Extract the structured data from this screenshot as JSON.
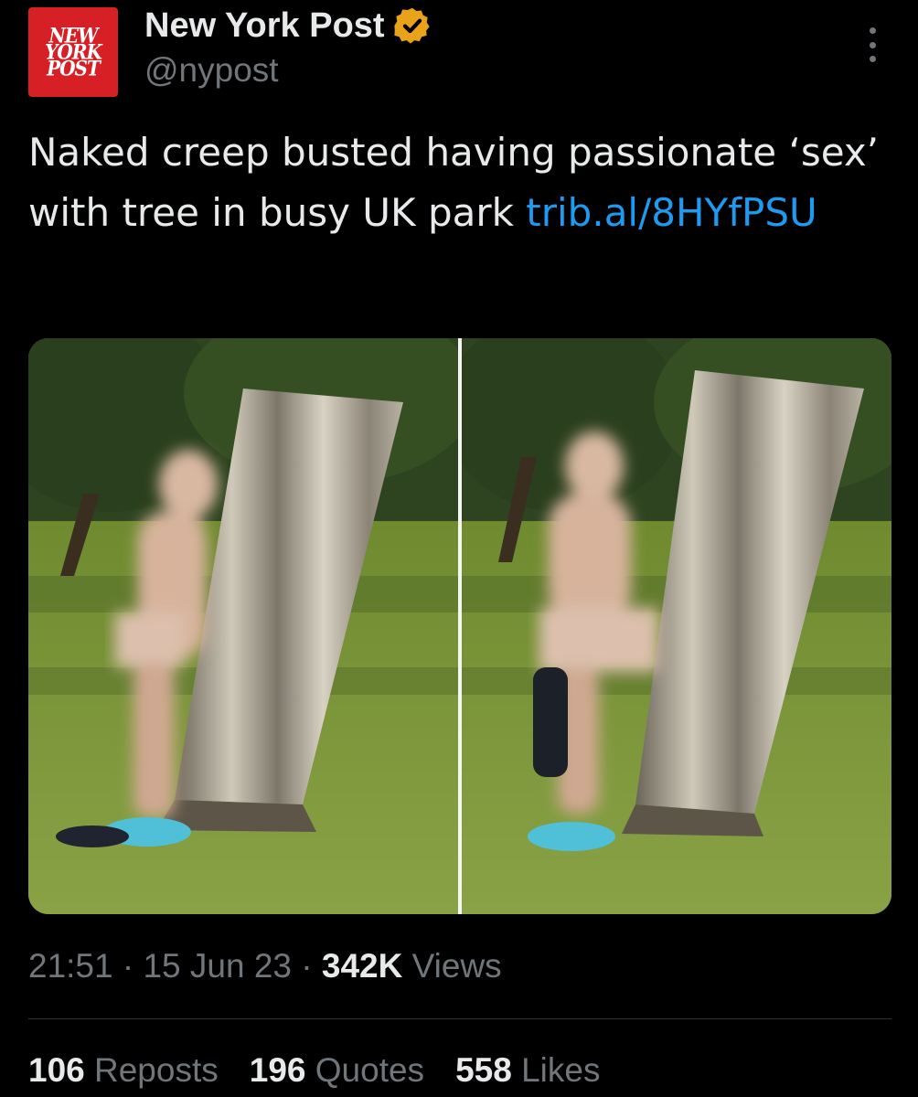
{
  "author": {
    "display_name": "New York Post",
    "handle": "@nypost",
    "avatar_logo_lines": [
      "NEW",
      "YORK",
      "POST"
    ],
    "verified_color": "#e8a31b",
    "avatar_color": "#d71f26"
  },
  "tweet": {
    "text": "Naked creep busted having passionate ‘sex’ with tree in busy UK park ",
    "link_text": "trib.al/8HYfPSU",
    "link_color": "#1d9bf0"
  },
  "media": {
    "photo_count": 2
  },
  "meta": {
    "time": "21:51",
    "sep1": " · ",
    "date": "15 Jun 23",
    "sep2": " · ",
    "views_count": "342K",
    "views_label": " Views"
  },
  "stats": {
    "reposts_count": "106",
    "reposts_label": " Reposts",
    "quotes_count": "196",
    "quotes_label": " Quotes",
    "likes_count": "558",
    "likes_label": " Likes"
  },
  "icons": {
    "verified": "verified-badge-icon",
    "more": "more-options-icon"
  }
}
